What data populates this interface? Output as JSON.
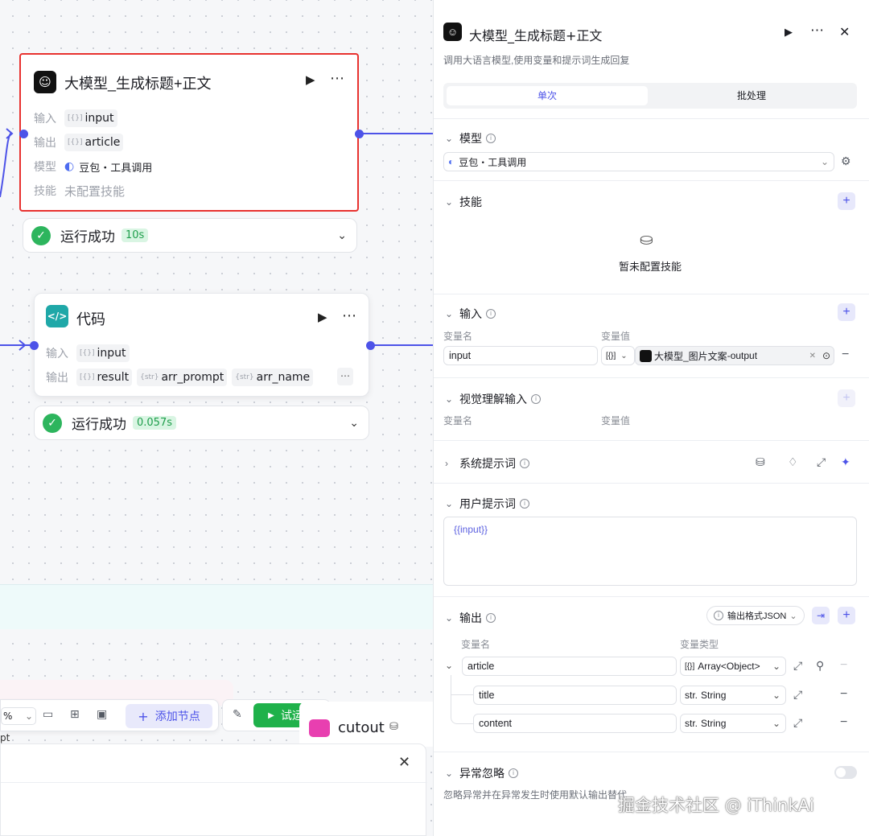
{
  "canvas": {
    "llm_node": {
      "title": "大模型_生成标题+正文",
      "rows": [
        {
          "label": "输入",
          "tag": "input",
          "prefix": "[{}]"
        },
        {
          "label": "输出",
          "tag": "article",
          "prefix": "[{}]"
        }
      ],
      "model_label": "模型",
      "model_value": "豆包・工具调用",
      "skill_label": "技能",
      "skill_value": "未配置技能",
      "status": "运行成功",
      "time": "10s"
    },
    "code_node": {
      "title": "代码",
      "input_label": "输入",
      "input_tag": "input",
      "output_label": "输出",
      "outputs": [
        "result",
        "arr_prompt",
        "arr_name"
      ],
      "prefix_obj": "[{}]",
      "prefix_str": "{str}",
      "status": "运行成功",
      "time": "0.057s"
    },
    "toolbar": {
      "zoom": "%",
      "add_node": "添加节点",
      "test_run": "试运行"
    },
    "cutout": "cutout",
    "partial_text": "pt"
  },
  "panel": {
    "title": "大模型_生成标题+正文",
    "subtitle": "调用大语言模型,使用变量和提示词生成回复",
    "tabs": [
      "单次",
      "批处理"
    ],
    "model": {
      "header": "模型",
      "value": "豆包・工具调用"
    },
    "skill": {
      "header": "技能",
      "empty": "暂未配置技能"
    },
    "input": {
      "header": "输入",
      "col_name": "变量名",
      "col_value": "变量值",
      "var": "input",
      "ref_type": "[{}]",
      "ref_node": "大模型_图片文案",
      "ref_sep": " - ",
      "ref_field": "output"
    },
    "vision": {
      "header": "视觉理解输入",
      "col_name": "变量名",
      "col_value": "变量值"
    },
    "system": {
      "header": "系统提示词"
    },
    "user": {
      "header": "用户提示词",
      "value": "{{input}}"
    },
    "output": {
      "header": "输出",
      "format": "输出格式JSON",
      "col_name": "变量名",
      "col_type": "变量类型",
      "rows": [
        {
          "name": "article",
          "type_prefix": "[{}]",
          "type": "Array<Object>"
        },
        {
          "name": "title",
          "type_prefix": "str.",
          "type": "String"
        },
        {
          "name": "content",
          "type_prefix": "str.",
          "type": "String"
        }
      ]
    },
    "ignore": {
      "header": "异常忽略",
      "desc": "忽略异常并在异常发生时使用默认输出替代"
    }
  },
  "watermark": "掘金技术社区 @ iThinkAi"
}
